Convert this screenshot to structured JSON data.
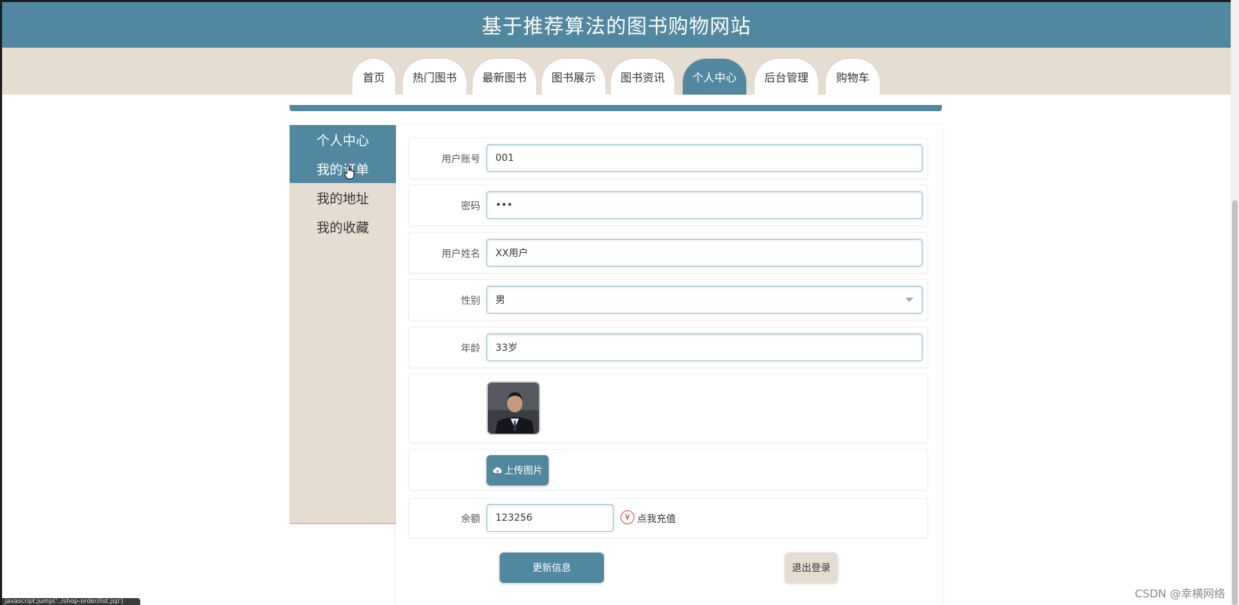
{
  "header": {
    "title": "基于推荐算法的图书购物网站"
  },
  "nav": {
    "tabs": [
      {
        "label": "首页"
      },
      {
        "label": "热门图书"
      },
      {
        "label": "最新图书"
      },
      {
        "label": "图书展示"
      },
      {
        "label": "图书资讯"
      },
      {
        "label": "个人中心",
        "active": true
      },
      {
        "label": "后台管理"
      },
      {
        "label": "购物车"
      }
    ]
  },
  "sidebar": {
    "items": [
      {
        "label": "个人中心"
      },
      {
        "label": "我的订单"
      },
      {
        "label": "我的地址"
      },
      {
        "label": "我的收藏"
      }
    ]
  },
  "form": {
    "account": {
      "label": "用户账号",
      "value": "001"
    },
    "password": {
      "label": "密码",
      "value": "•••"
    },
    "name": {
      "label": "用户姓名",
      "value": "XX用户"
    },
    "gender": {
      "label": "性别",
      "value": "男"
    },
    "age": {
      "label": "年龄",
      "value": "33岁"
    },
    "upload_label": "上传图片",
    "balance": {
      "label": "余额",
      "value": "123256"
    },
    "recharge_icon": "¥",
    "recharge_label": "点我充值",
    "update_button": "更新信息",
    "logout_button": "退出登录"
  },
  "statusbar": {
    "text": "javascript:jump('../shop-order/list.jsp')"
  },
  "watermark": "CSDN @幸横网络",
  "colors": {
    "primary": "#51889f",
    "beige": "#e6ddd2",
    "recharge_red": "#e0372f"
  }
}
